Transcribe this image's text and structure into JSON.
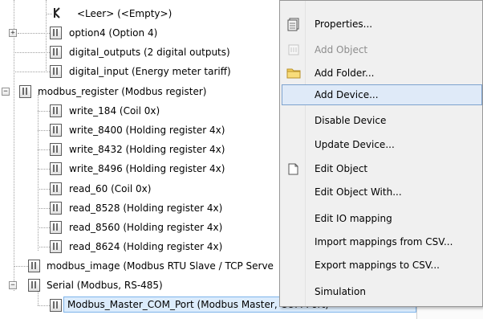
{
  "tree": {
    "nodes": [
      {
        "id": "leer",
        "label": "<Leer> (<Empty>)"
      },
      {
        "id": "option4",
        "label": "option4 (Option 4)",
        "expander": "+"
      },
      {
        "id": "digital_outputs",
        "label": "digital_outputs (2 digital outputs)"
      },
      {
        "id": "digital_input",
        "label": "digital_input (Energy meter tariff)"
      },
      {
        "id": "modbus_register",
        "label": "modbus_register (Modbus register)",
        "expander": "−"
      },
      {
        "id": "write_184",
        "label": "write_184 (Coil 0x)"
      },
      {
        "id": "write_8400",
        "label": "write_8400 (Holding register 4x)"
      },
      {
        "id": "write_8432",
        "label": "write_8432 (Holding register 4x)"
      },
      {
        "id": "write_8496",
        "label": "write_8496 (Holding register 4x)"
      },
      {
        "id": "read_60",
        "label": "read_60 (Coil 0x)"
      },
      {
        "id": "read_8528",
        "label": "read_8528 (Holding register 4x)"
      },
      {
        "id": "read_8560",
        "label": "read_8560 (Holding register 4x)"
      },
      {
        "id": "read_8624",
        "label": "read_8624 (Holding register 4x)"
      },
      {
        "id": "modbus_image",
        "label": "modbus_image (Modbus RTU Slave / TCP Serve"
      },
      {
        "id": "serial",
        "label": "Serial (Modbus, RS-485)",
        "expander": "−"
      },
      {
        "id": "modbus_master",
        "label": "Modbus_Master_COM_Port (Modbus Master, COM Port)"
      }
    ]
  },
  "context_menu": {
    "items": [
      {
        "label": "Properties...",
        "icon": "properties-icon",
        "enabled": true
      },
      {
        "label": "Add Object",
        "icon": "add-object-icon",
        "enabled": false
      },
      {
        "label": "Add Folder...",
        "icon": "folder-icon",
        "enabled": true
      },
      {
        "label": "Add Device...",
        "icon": "",
        "enabled": true,
        "highlighted": true
      },
      {
        "label": "Disable Device",
        "icon": "",
        "enabled": true
      },
      {
        "label": "Update Device...",
        "icon": "",
        "enabled": true
      },
      {
        "label": "Edit Object",
        "icon": "edit-object-icon",
        "enabled": true
      },
      {
        "label": "Edit Object With...",
        "icon": "",
        "enabled": true
      },
      {
        "label": "Edit IO mapping",
        "icon": "",
        "enabled": true
      },
      {
        "label": "Import mappings from CSV...",
        "icon": "",
        "enabled": true
      },
      {
        "label": "Export mappings to CSV...",
        "icon": "",
        "enabled": true
      },
      {
        "label": "Simulation",
        "icon": "",
        "enabled": true
      }
    ]
  },
  "colors": {
    "highlight_bg": "#dfeaf8",
    "highlight_border": "#7da2ce",
    "selection_bg": "#dcecfc",
    "disabled_text": "#8d8d8d"
  }
}
